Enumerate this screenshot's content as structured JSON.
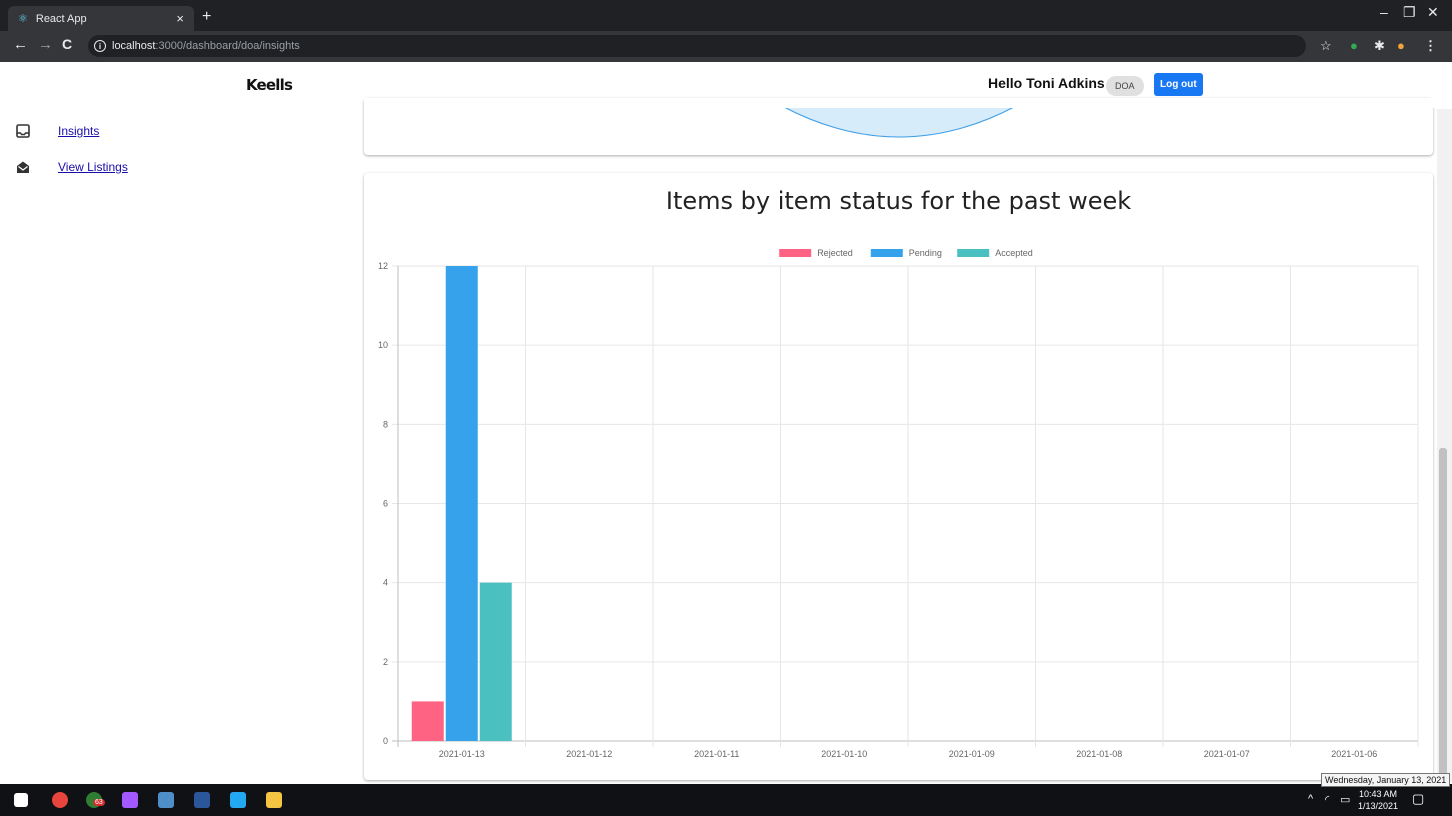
{
  "browser": {
    "tab_title": "React App",
    "tab_close": "×",
    "new_tab": "+",
    "url_host": "localhost",
    "url_path": ":3000/dashboard/doa/insights"
  },
  "header": {
    "brand": "Keells",
    "greeting": "Hello Toni Adkins",
    "role": "DOA",
    "logout_label": "Log out"
  },
  "sidebar": {
    "items": [
      {
        "label": "Insights",
        "icon": "inbox-icon"
      },
      {
        "label": "View Listings",
        "icon": "envelope-open-icon"
      }
    ]
  },
  "chart_data": {
    "type": "bar",
    "title": "Items by item status for the past week",
    "categories": [
      "2021-01-13",
      "2021-01-12",
      "2021-01-11",
      "2021-01-10",
      "2021-01-09",
      "2021-01-08",
      "2021-01-07",
      "2021-01-06"
    ],
    "series": [
      {
        "name": "Rejected",
        "color": "#ff6384",
        "values": [
          1,
          0,
          0,
          0,
          0,
          0,
          0,
          0
        ]
      },
      {
        "name": "Pending",
        "color": "#36a2eb",
        "values": [
          12,
          0,
          0,
          0,
          0,
          0,
          0,
          0
        ]
      },
      {
        "name": "Accepted",
        "color": "#4bc0c0",
        "values": [
          4,
          0,
          0,
          0,
          0,
          0,
          0,
          0
        ]
      }
    ],
    "ylim": [
      0,
      12
    ],
    "yticks": [
      0,
      2,
      4,
      6,
      8,
      10,
      12
    ],
    "grid": true,
    "legend": "top-center"
  },
  "taskbar": {
    "time": "10:43 AM",
    "date": "1/13/2021",
    "tooltip": "Wednesday, January 13, 2021",
    "badge": "63"
  }
}
